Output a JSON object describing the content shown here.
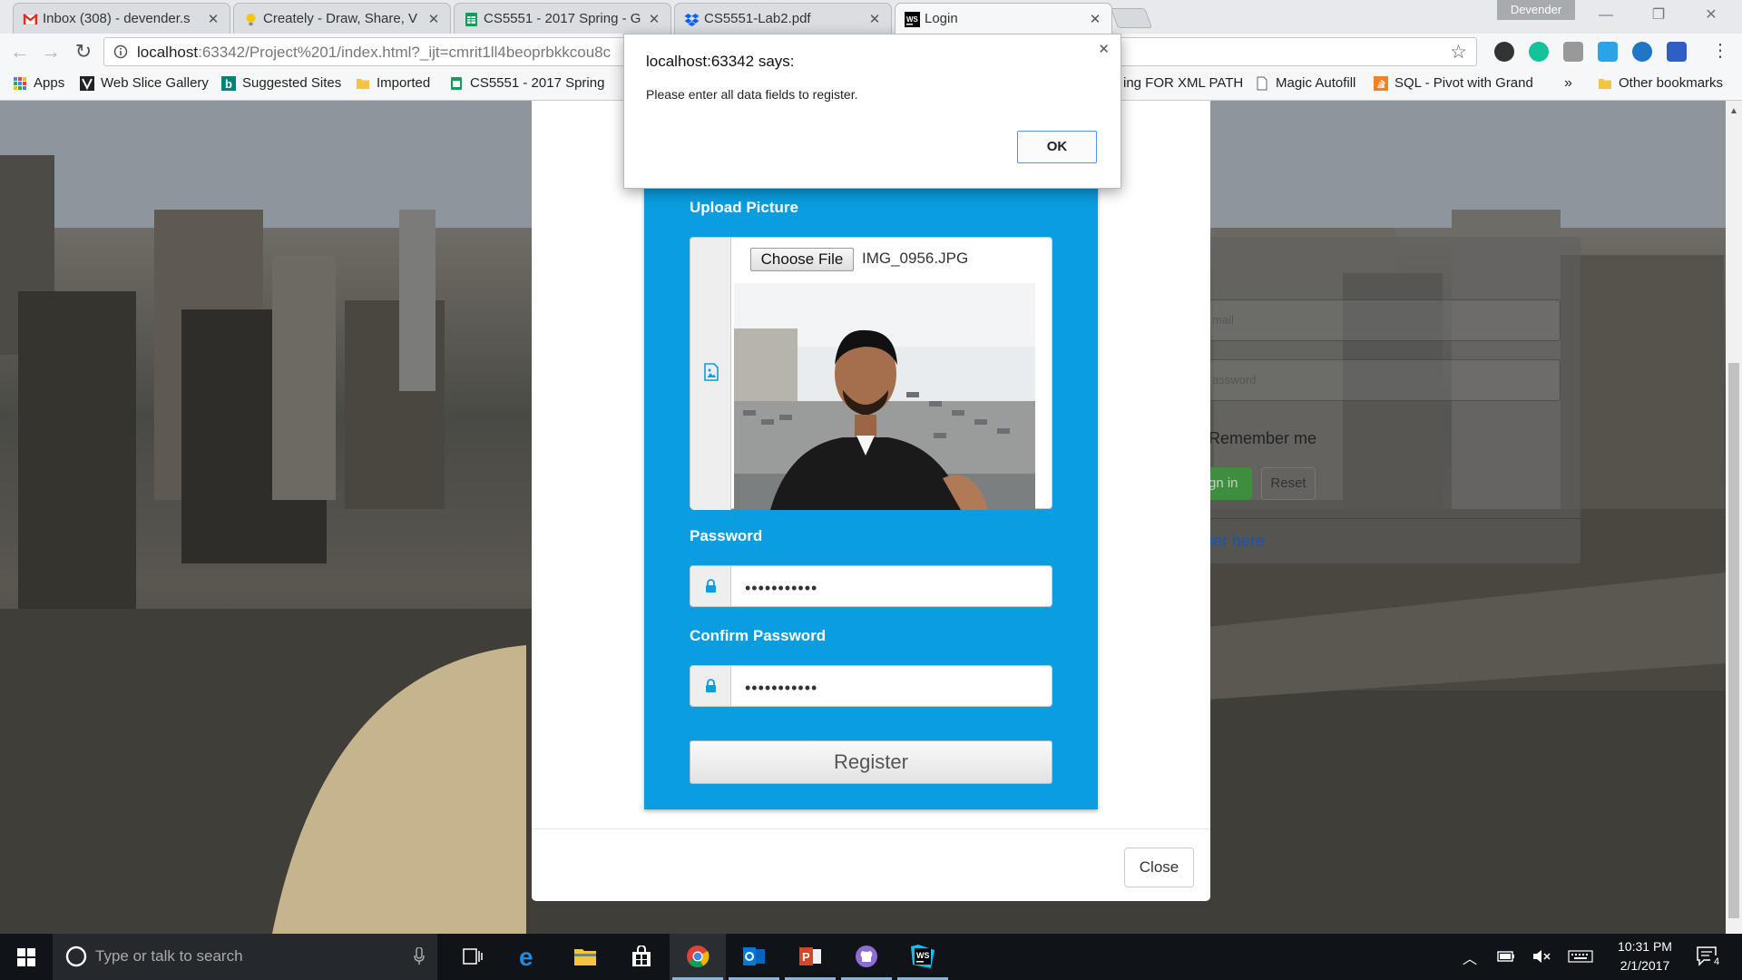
{
  "browser": {
    "tabs": [
      {
        "title": "Inbox (308) - devender.s",
        "icon": "gmail-icon",
        "active": false
      },
      {
        "title": "Creately - Draw, Share, V",
        "icon": "creately-icon",
        "active": false
      },
      {
        "title": "CS5551 - 2017 Spring - G",
        "icon": "sheets-icon",
        "active": false
      },
      {
        "title": "CS5551-Lab2.pdf",
        "icon": "dropbox-icon",
        "active": false
      },
      {
        "title": "Login",
        "icon": "webstorm-icon",
        "active": true
      }
    ],
    "profile_name": "Devender",
    "url": "localhost:63342/Project%201/index.html?_ijt=cmrit1ll4beoprbkkcou8c",
    "url_host": "localhost",
    "bookmarks": [
      {
        "label": "Apps",
        "icon": "apps-grid-icon"
      },
      {
        "label": "Web Slice Gallery",
        "icon": "web-slice-icon"
      },
      {
        "label": "Suggested Sites",
        "icon": "bing-icon"
      },
      {
        "label": "Imported",
        "icon": "folder-icon"
      },
      {
        "label": "CS5551 - 2017 Spring",
        "icon": "sheets-icon"
      },
      {
        "label": "ing FOR XML PATH",
        "icon": "page-icon"
      },
      {
        "label": "Magic Autofill",
        "icon": "page-icon"
      },
      {
        "label": "SQL - Pivot with Grand",
        "icon": "stackoverflow-icon"
      }
    ],
    "bookmarks_overflow": "»",
    "other_bookmarks": "Other bookmarks"
  },
  "alert": {
    "title": "localhost:63342 says:",
    "message": "Please enter all data fields to register.",
    "ok_label": "OK"
  },
  "register_form": {
    "upload_label": "Upload Picture",
    "choose_file_label": "Choose File",
    "file_name": "IMG_0956.JPG",
    "password_label": "Password",
    "password_value": "•••••••••••",
    "confirm_label": "Confirm Password",
    "confirm_value": "•••••••••••",
    "register_label": "Register"
  },
  "modal": {
    "close_label": "Close"
  },
  "login_card": {
    "email_placeholder": "mail",
    "password_placeholder": "assword",
    "remember_label": "Remember me",
    "signin_label": "gn in",
    "reset_label": "Reset",
    "register_link": "ter here"
  },
  "taskbar": {
    "search_placeholder": "Type or talk to search",
    "time": "10:31 PM",
    "date": "2/1/2017",
    "notification_count": "4",
    "apps": [
      {
        "name": "task-view-icon",
        "running": false
      },
      {
        "name": "edge-icon",
        "running": false
      },
      {
        "name": "file-explorer-icon",
        "running": false
      },
      {
        "name": "store-icon",
        "running": false
      },
      {
        "name": "chrome-icon",
        "running": true
      },
      {
        "name": "outlook-icon",
        "running": true
      },
      {
        "name": "powerpoint-icon",
        "running": true
      },
      {
        "name": "github-icon",
        "running": true
      },
      {
        "name": "webstorm-icon",
        "running": true
      }
    ]
  },
  "colors": {
    "panel_blue": "#0a9de0",
    "ok_border": "#4d90fe",
    "taskbar": "#101317"
  }
}
